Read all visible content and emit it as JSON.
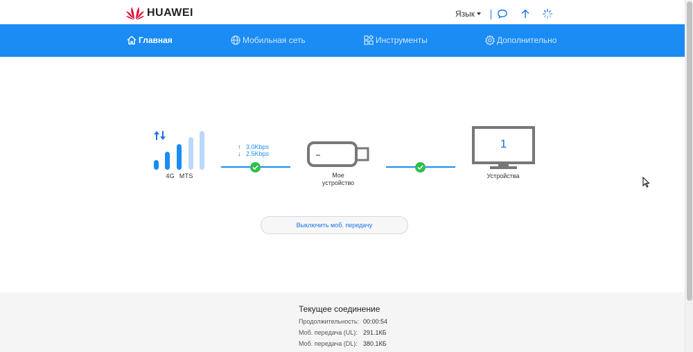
{
  "brand": {
    "name": "HUAWEI"
  },
  "header": {
    "language_label": "Язык",
    "icons": [
      "message-icon",
      "upload-icon",
      "loading-icon"
    ]
  },
  "nav": {
    "items": [
      {
        "label": "Главная",
        "icon": "home-icon",
        "active": true
      },
      {
        "label": "Мобильная сеть",
        "icon": "globe-icon",
        "active": false
      },
      {
        "label": "Инструменты",
        "icon": "tools-icon",
        "active": false
      },
      {
        "label": "Дополнительно",
        "icon": "gear-icon",
        "active": false
      }
    ]
  },
  "network": {
    "type": "4G",
    "operator": "MTS",
    "signal_bars_filled": 3,
    "signal_bars_total": 5
  },
  "speed": {
    "up": "3.0Kbps",
    "down": "2.5Kbps"
  },
  "device": {
    "label_line1": "Мое",
    "label_line2": "устройство"
  },
  "clients": {
    "count": "1",
    "label": "Устройства"
  },
  "actions": {
    "toggle_data_label": "Выключить моб. передачу"
  },
  "connection": {
    "title": "Текущее соединение",
    "rows": [
      {
        "key": "Продолжительность:",
        "value": "00:00:54"
      },
      {
        "key": "Моб. передача (UL):",
        "value": "291.1КБ"
      },
      {
        "key": "Моб. передача (DL):",
        "value": "380.1КБ"
      }
    ]
  },
  "colors": {
    "accent": "#1a8cf4",
    "ok": "#2dbf4d",
    "brand_red": "#e4002b"
  }
}
